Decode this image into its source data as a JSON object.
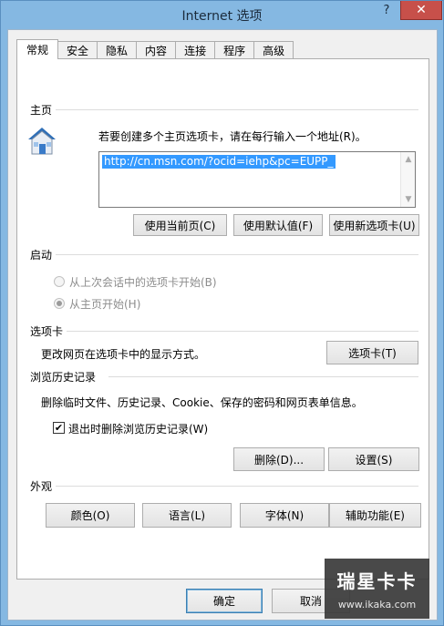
{
  "window": {
    "title": "Internet 选项",
    "help_glyph": "?",
    "close_glyph": "✕"
  },
  "tabs": [
    {
      "label": "常规",
      "active": true
    },
    {
      "label": "安全"
    },
    {
      "label": "隐私"
    },
    {
      "label": "内容"
    },
    {
      "label": "连接"
    },
    {
      "label": "程序"
    },
    {
      "label": "高级"
    }
  ],
  "home": {
    "heading": "主页",
    "instruction": "若要创建多个主页选项卡，请在每行输入一个地址(R)。",
    "url": "http://cn.msn.com/?ocid=iehp&pc=EUPP_",
    "buttons": {
      "use_current": "使用当前页(C)",
      "use_default": "使用默认值(F)",
      "use_new_tab": "使用新选项卡(U)"
    }
  },
  "startup": {
    "heading": "启动",
    "option_last_session": "从上次会话中的选项卡开始(B)",
    "option_home_page": "从主页开始(H)",
    "selected": "option_home_page"
  },
  "tabs_section": {
    "heading": "选项卡",
    "description": "更改网页在选项卡中的显示方式。",
    "button": "选项卡(T)"
  },
  "history": {
    "heading": "浏览历史记录",
    "description": "删除临时文件、历史记录、Cookie、保存的密码和网页表单信息。",
    "checkbox_label": "退出时删除浏览历史记录(W)",
    "checkbox_checked": true,
    "delete_button": "删除(D)...",
    "settings_button": "设置(S)"
  },
  "appearance": {
    "heading": "外观",
    "colors_button": "颜色(O)",
    "languages_button": "语言(L)",
    "fonts_button": "字体(N)",
    "accessibility_button": "辅助功能(E)"
  },
  "footer": {
    "ok_button": "确定",
    "cancel_button": "取消"
  },
  "watermark": {
    "logo": "瑞星卡卡",
    "url": "www.ikaka.com"
  }
}
